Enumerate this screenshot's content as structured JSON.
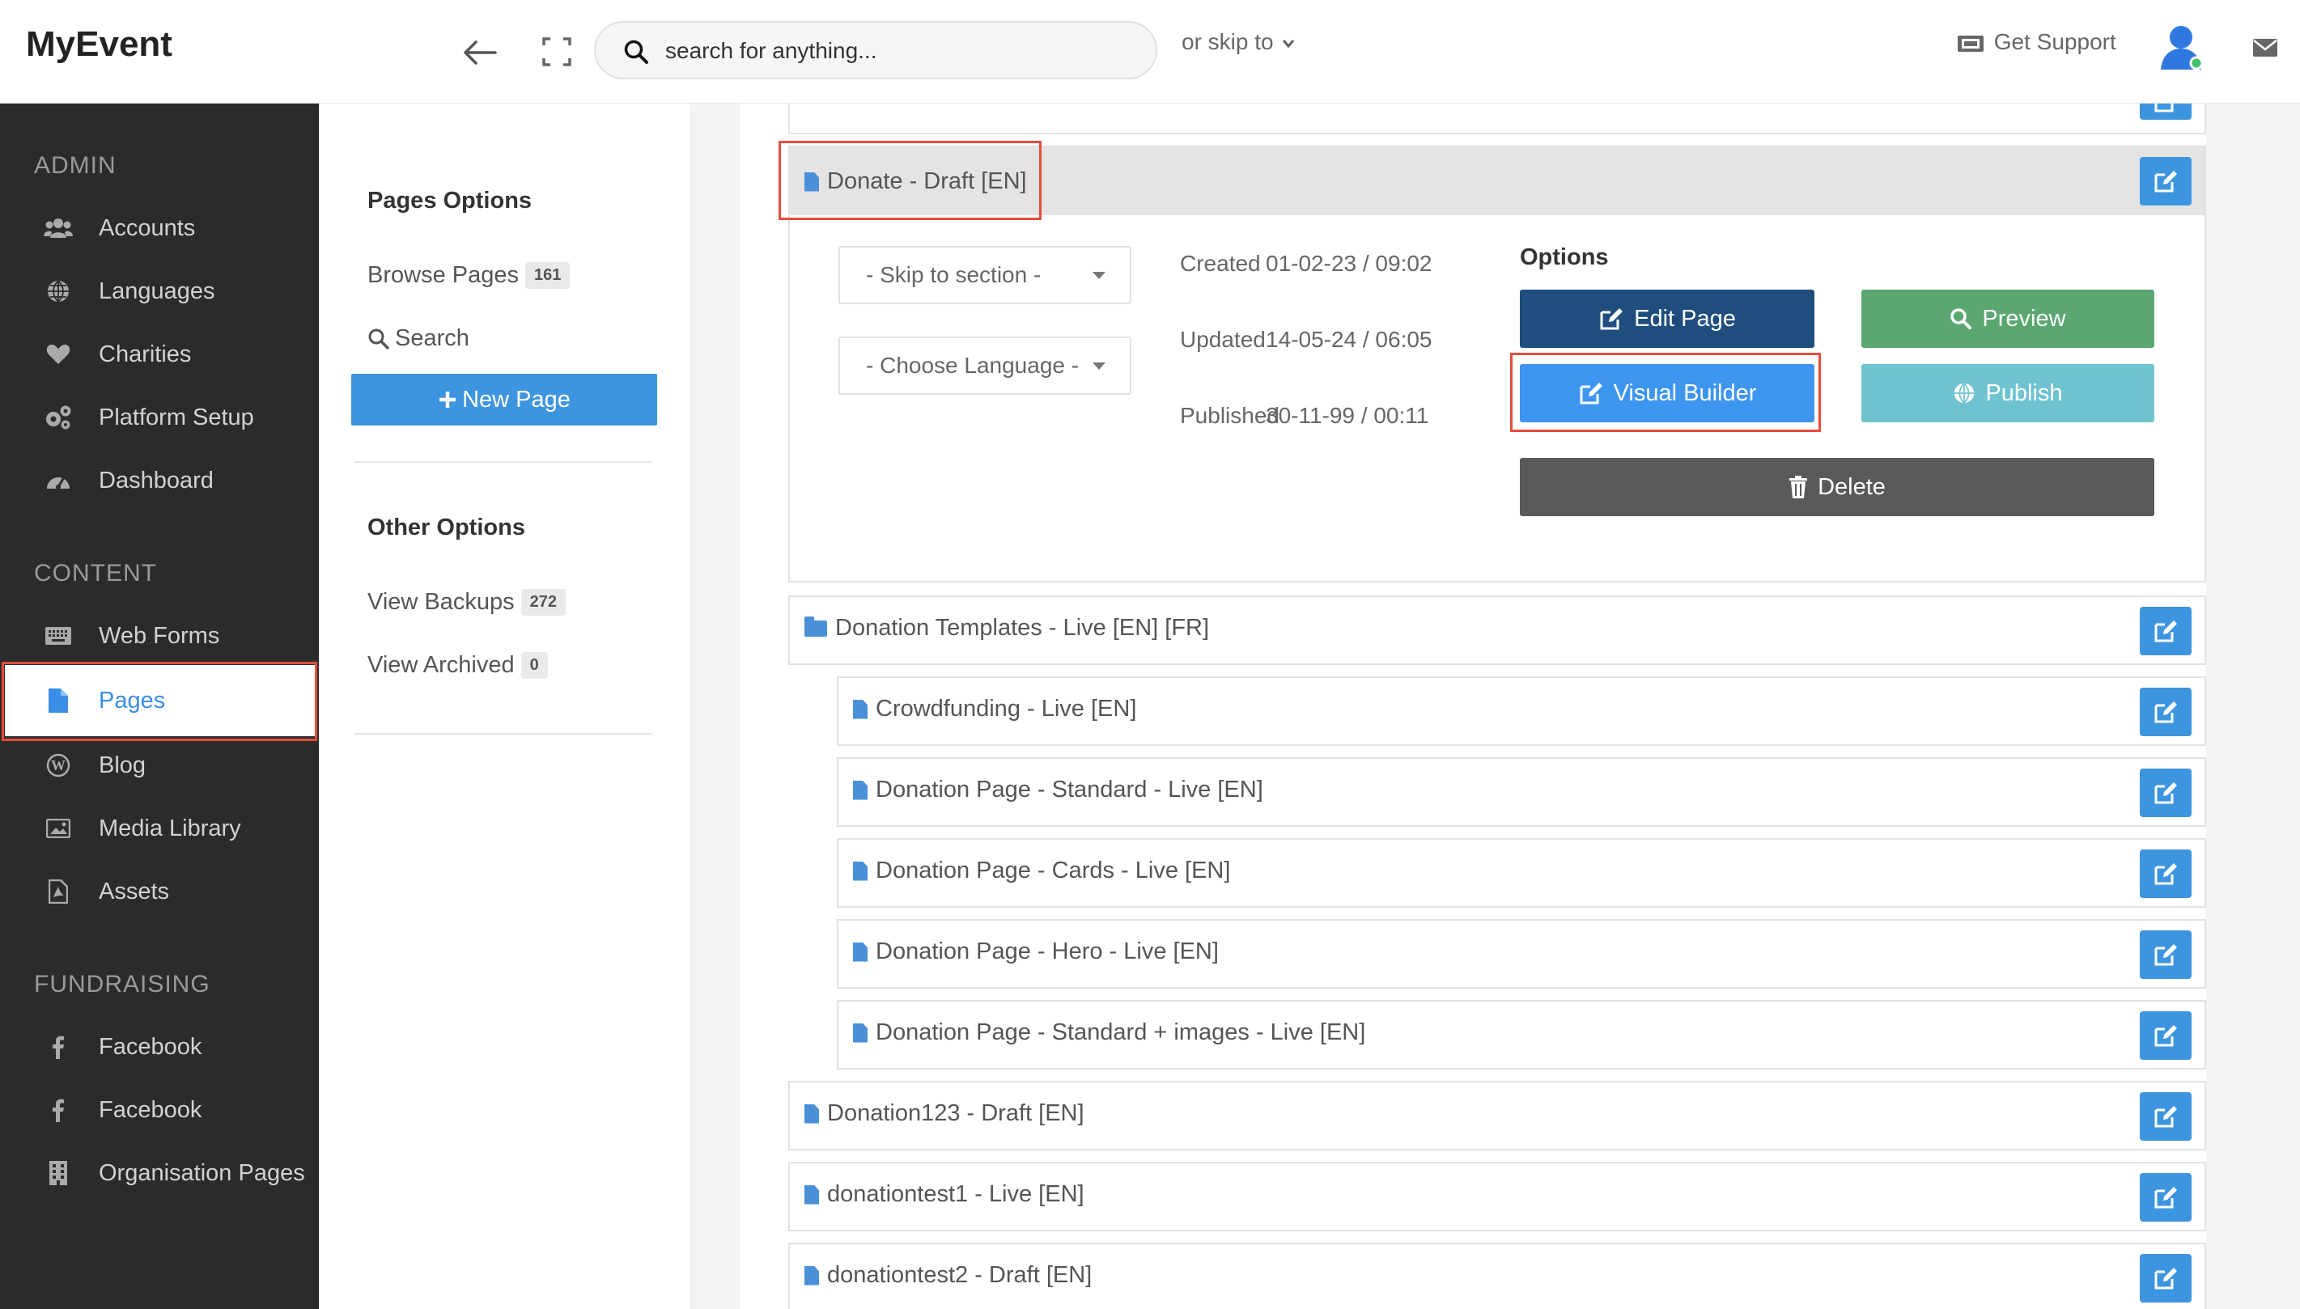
{
  "header": {
    "brand": "MyEvent",
    "search_placeholder": "search for anything...",
    "skip_to": "or skip to",
    "support": "Get Support"
  },
  "sidebar": {
    "sections": [
      {
        "title": "ADMIN"
      },
      {
        "title": "CONTENT"
      },
      {
        "title": "FUNDRAISING"
      }
    ],
    "items": [
      {
        "label": "Accounts",
        "icon": "users-icon"
      },
      {
        "label": "Languages",
        "icon": "globe-icon"
      },
      {
        "label": "Charities",
        "icon": "heart-icon"
      },
      {
        "label": "Platform Setup",
        "icon": "cogs-icon"
      },
      {
        "label": "Dashboard",
        "icon": "dashboard-icon"
      },
      {
        "label": "Web Forms",
        "icon": "keyboard-icon"
      },
      {
        "label": "Pages",
        "icon": "file-icon",
        "active": true
      },
      {
        "label": "Blog",
        "icon": "wordpress-icon"
      },
      {
        "label": "Media Library",
        "icon": "image-icon"
      },
      {
        "label": "Assets",
        "icon": "file-pdf-icon"
      },
      {
        "label": "Facebook",
        "icon": "facebook-icon"
      },
      {
        "label": "Facebook",
        "icon": "facebook-icon"
      },
      {
        "label": "Organisation Pages",
        "icon": "building-icon"
      }
    ]
  },
  "options": {
    "pages_title": "Pages Options",
    "browse_label": "Browse Pages",
    "browse_count": "161",
    "search_label": "Search",
    "new_page_label": "New Page",
    "other_title": "Other Options",
    "backups_label": "View Backups",
    "backups_count": "272",
    "archived_label": "View Archived",
    "archived_count": "0"
  },
  "expanded": {
    "title": "Donate - Draft [EN]",
    "skip_section": "- Skip to section -",
    "choose_language": "- Choose Language -",
    "created_label": "Created",
    "created_value": "01-02-23 / 09:02",
    "updated_label": "Updated",
    "updated_value": "14-05-24 / 06:05",
    "published_label": "Published",
    "published_value": "30-11-99 / 00:11",
    "options_title": "Options",
    "edit_page": "Edit Page",
    "preview": "Preview",
    "visual_builder": "Visual Builder",
    "publish": "Publish",
    "delete": "Delete"
  },
  "rows": [
    {
      "label": "Donation Templates - Live [EN] [FR]",
      "type": "folder"
    },
    {
      "label": "Crowdfunding - Live [EN]",
      "type": "page"
    },
    {
      "label": "Donation Page - Standard - Live [EN]",
      "type": "page"
    },
    {
      "label": "Donation Page - Cards - Live [EN]",
      "type": "page"
    },
    {
      "label": "Donation Page - Hero - Live [EN]",
      "type": "page"
    },
    {
      "label": "Donation Page - Standard + images - Live [EN]",
      "type": "page"
    },
    {
      "label": "Donation123 - Draft [EN]",
      "type": "page"
    },
    {
      "label": "donationtest1 - Live [EN]",
      "type": "page"
    },
    {
      "label": "donationtest2 - Draft [EN]",
      "type": "page"
    }
  ],
  "colors": {
    "accent": "#3d95df",
    "edit_page": "#1f4e7e",
    "preview": "#5aa772",
    "visual_builder": "#3d95ef",
    "publish": "#6fc3d1",
    "delete": "#595959",
    "highlight": "#e74c3c"
  }
}
